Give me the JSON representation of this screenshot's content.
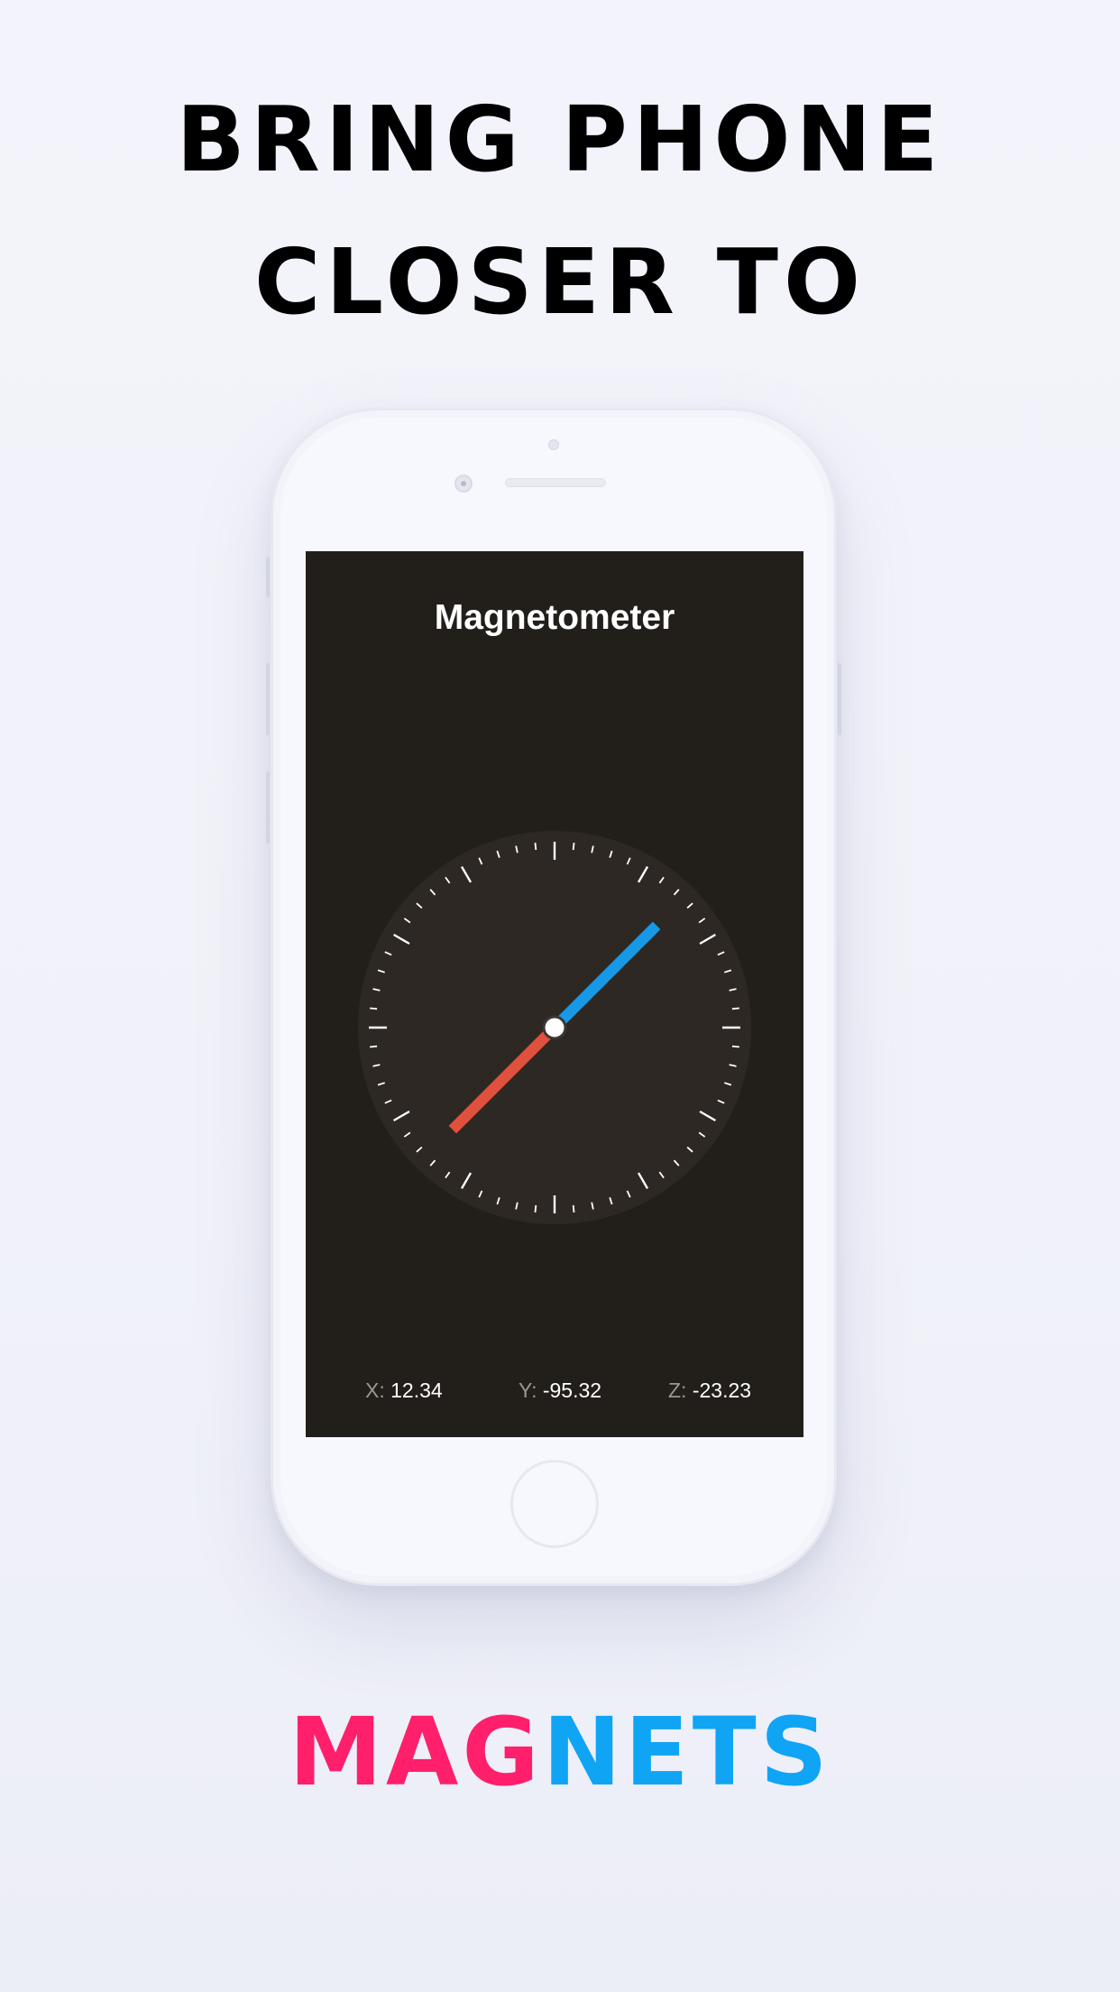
{
  "headline": {
    "line1": "BRING PHONE",
    "line2": "CLOSER TO"
  },
  "magnets_word": {
    "part1": "MAG",
    "part2": "NETS",
    "color1": "#ff1f6b",
    "color2": "#10a4f5"
  },
  "app": {
    "title": "Magnetometer",
    "background": "#221f1b",
    "dial_background": "#2d2824",
    "needle_north_color": "#1799e6",
    "needle_south_color": "#e0513d",
    "needle_heading_deg": 45,
    "readouts": {
      "x": {
        "label": "X:",
        "value": "12.34"
      },
      "y": {
        "label": "Y:",
        "value": "-95.32"
      },
      "z": {
        "label": "Z:",
        "value": "-23.23"
      }
    }
  },
  "icons": [
    "front-camera-icon",
    "speaker-icon",
    "sensor-icon",
    "home-button-icon"
  ]
}
